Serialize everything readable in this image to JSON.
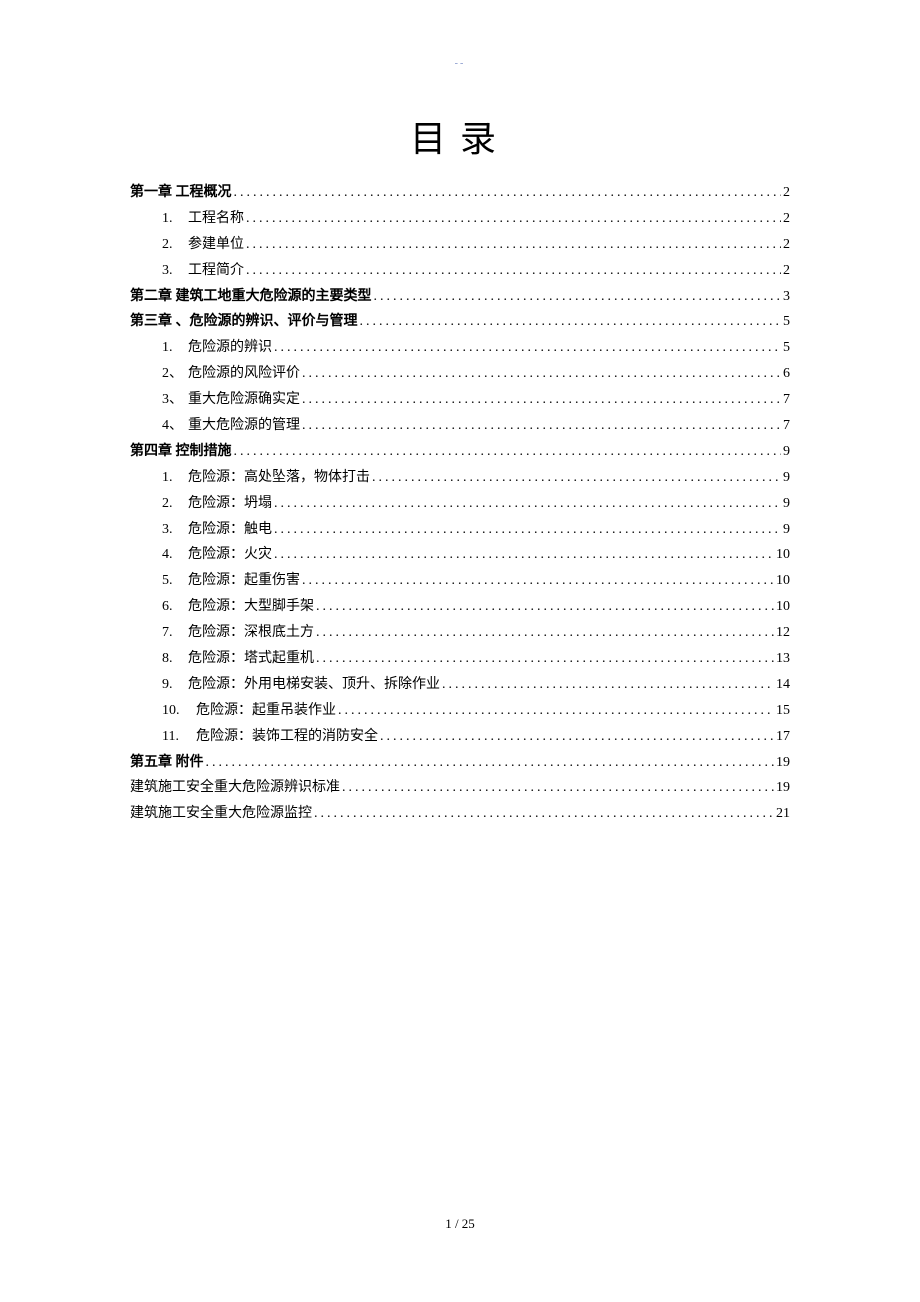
{
  "header_mark": "--",
  "title": "目录",
  "toc": [
    {
      "level": 0,
      "bold": true,
      "num": "",
      "label": "第一章 工程概况",
      "page": "2"
    },
    {
      "level": 1,
      "bold": false,
      "num": "1.",
      "label": "工程名称",
      "page": "2"
    },
    {
      "level": 1,
      "bold": false,
      "num": "2.",
      "label": "参建单位",
      "page": "2"
    },
    {
      "level": 1,
      "bold": false,
      "num": "3.",
      "label": "工程简介",
      "page": "2"
    },
    {
      "level": 0,
      "bold": true,
      "num": "",
      "label": "第二章 建筑工地重大危险源的主要类型",
      "page": "3"
    },
    {
      "level": 0,
      "bold": true,
      "num": "",
      "label": "第三章 、危险源的辨识、评价与管理",
      "page": "5"
    },
    {
      "level": 1,
      "bold": false,
      "num": "1.",
      "label": "危险源的辨识",
      "page": "5"
    },
    {
      "level": 1,
      "bold": false,
      "num": "2、",
      "label": " 危险源的风险评价",
      "page": "6"
    },
    {
      "level": 1,
      "bold": false,
      "num": "3、",
      "label": " 重大危险源确实定",
      "page": "7"
    },
    {
      "level": 1,
      "bold": false,
      "num": "4、",
      "label": " 重大危险源的管理",
      "page": "7"
    },
    {
      "level": 0,
      "bold": true,
      "num": "",
      "label": "第四章 控制措施",
      "page": "9"
    },
    {
      "level": 1,
      "bold": false,
      "num": "1.",
      "label": "危险源：高处坠落，物体打击",
      "page": "9"
    },
    {
      "level": 1,
      "bold": false,
      "num": "2.",
      "label": "危险源：坍塌",
      "page": "9"
    },
    {
      "level": 1,
      "bold": false,
      "num": "3.",
      "label": "危险源：触电",
      "page": "9"
    },
    {
      "level": 1,
      "bold": false,
      "num": "4.",
      "label": "危险源：火灾",
      "page": "10"
    },
    {
      "level": 1,
      "bold": false,
      "num": "5.",
      "label": "危险源：起重伤害",
      "page": "10"
    },
    {
      "level": 1,
      "bold": false,
      "num": "6.",
      "label": "危险源：大型脚手架",
      "page": "10"
    },
    {
      "level": 1,
      "bold": false,
      "num": "7.",
      "label": "危险源：深根底土方",
      "page": "12"
    },
    {
      "level": 1,
      "bold": false,
      "num": "8.",
      "label": "危险源：塔式起重机",
      "page": "13"
    },
    {
      "level": 1,
      "bold": false,
      "num": "9.",
      "label": "危险源：外用电梯安装、顶升、拆除作业",
      "page": "14"
    },
    {
      "level": 1,
      "bold": false,
      "num": "10.",
      "label": " 危险源：起重吊装作业",
      "page": "15",
      "wide": true
    },
    {
      "level": 1,
      "bold": false,
      "num": "11.",
      "label": " 危险源：装饰工程的消防安全",
      "page": "17",
      "wide": true
    },
    {
      "level": 0,
      "bold": true,
      "num": "",
      "label": "第五章 附件",
      "page": "19"
    },
    {
      "level": "appendix",
      "bold": false,
      "num": "",
      "label": "建筑施工安全重大危险源辨识标准",
      "page": "19"
    },
    {
      "level": "appendix",
      "bold": false,
      "num": "",
      "label": "建筑施工安全重大危险源监控",
      "page": "21"
    }
  ],
  "footer": "1 / 25"
}
